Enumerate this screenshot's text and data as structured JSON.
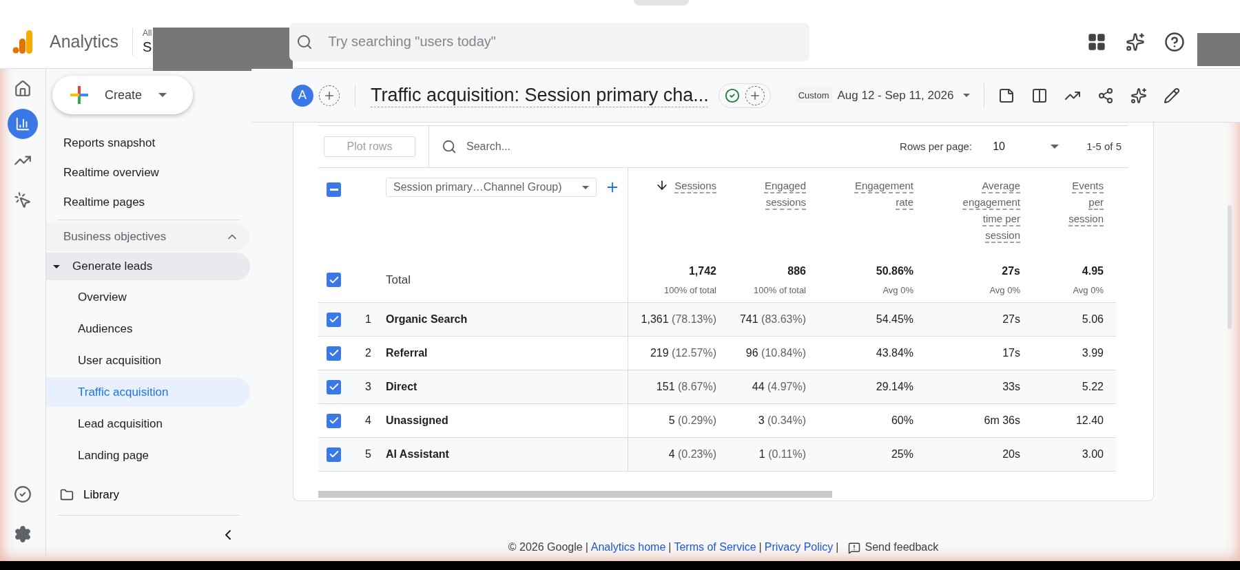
{
  "header": {
    "product": "Analytics",
    "breadcrumb": "All",
    "account": "S",
    "search_placeholder": "Try searching \"users today\""
  },
  "nav": {
    "create_label": "Create",
    "items": [
      {
        "kind": "item",
        "label": "Reports snapshot",
        "selected": false
      },
      {
        "kind": "item",
        "label": "Realtime overview",
        "selected": false
      },
      {
        "kind": "item",
        "label": "Realtime pages",
        "selected": false
      },
      {
        "kind": "section",
        "label": "Business objectives",
        "expanded": true
      },
      {
        "kind": "group",
        "label": "Generate leads",
        "expanded": true,
        "children": [
          {
            "label": "Overview",
            "selected": false
          },
          {
            "label": "Audiences",
            "selected": false
          },
          {
            "label": "User acquisition",
            "selected": false
          },
          {
            "label": "Traffic acquisition",
            "selected": true
          },
          {
            "label": "Lead acquisition",
            "selected": false
          },
          {
            "label": "Landing page",
            "selected": false
          }
        ]
      },
      {
        "kind": "folder",
        "label": "Library",
        "selected": false
      }
    ]
  },
  "report": {
    "avatar": "A",
    "title": "Traffic acquisition: Session primary cha...",
    "date_badge": "Custom",
    "date_range": "Aug 12 - Sep 11, 2026"
  },
  "table": {
    "plot_rows": "Plot rows",
    "search_placeholder": "Search...",
    "rows_per_page_label": "Rows per page:",
    "rows_per_page": "10",
    "range": "1-5 of 5",
    "select_all": {
      "indeterminate": true
    },
    "dimension": "Session primary…Channel Group)",
    "columns": [
      {
        "label": "Sessions",
        "sorted": true
      },
      {
        "label": "Engaged sessions",
        "sorted": false
      },
      {
        "label": "Engagement rate",
        "sorted": false
      },
      {
        "label": "Average engagement time per session",
        "sorted": false
      },
      {
        "label": "Events per session",
        "sorted": false
      }
    ],
    "total": {
      "label": "Total",
      "checked": true,
      "cells": [
        {
          "value": "1,742",
          "sub": "100% of total"
        },
        {
          "value": "886",
          "sub": "100% of total"
        },
        {
          "value": "50.86%",
          "sub": "Avg 0%"
        },
        {
          "value": "27s",
          "sub": "Avg 0%"
        },
        {
          "value": "4.95",
          "sub": "Avg 0%"
        }
      ]
    },
    "rows": [
      {
        "index": "1",
        "name": "Organic Search",
        "checked": true,
        "cells": [
          {
            "value": "1,361",
            "share": "(78.13%)"
          },
          {
            "value": "741",
            "share": "(83.63%)"
          },
          {
            "value": "54.45%"
          },
          {
            "value": "27s"
          },
          {
            "value": "5.06"
          }
        ]
      },
      {
        "index": "2",
        "name": "Referral",
        "checked": true,
        "cells": [
          {
            "value": "219",
            "share": "(12.57%)"
          },
          {
            "value": "96",
            "share": "(10.84%)"
          },
          {
            "value": "43.84%"
          },
          {
            "value": "17s"
          },
          {
            "value": "3.99"
          }
        ]
      },
      {
        "index": "3",
        "name": "Direct",
        "checked": true,
        "cells": [
          {
            "value": "151",
            "share": "(8.67%)"
          },
          {
            "value": "44",
            "share": "(4.97%)"
          },
          {
            "value": "29.14%"
          },
          {
            "value": "33s"
          },
          {
            "value": "5.22"
          }
        ]
      },
      {
        "index": "4",
        "name": "Unassigned",
        "checked": true,
        "cells": [
          {
            "value": "5",
            "share": "(0.29%)"
          },
          {
            "value": "3",
            "share": "(0.34%)"
          },
          {
            "value": "60%"
          },
          {
            "value": "6m 36s"
          },
          {
            "value": "12.40"
          }
        ]
      },
      {
        "index": "5",
        "name": "AI Assistant",
        "checked": true,
        "cells": [
          {
            "value": "4",
            "share": "(0.23%)"
          },
          {
            "value": "1",
            "share": "(0.11%)"
          },
          {
            "value": "25%"
          },
          {
            "value": "20s"
          },
          {
            "value": "3.00"
          }
        ]
      }
    ]
  },
  "footer": {
    "copyright": "© 2026 Google",
    "separator": "|",
    "links": [
      "Analytics home",
      "Terms of Service",
      "Privacy Policy"
    ],
    "feedback": "Send feedback"
  }
}
